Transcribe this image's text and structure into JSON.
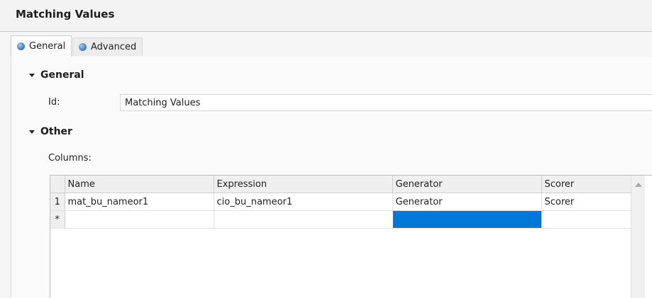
{
  "window": {
    "title": "Matching Values"
  },
  "tabs": [
    {
      "label": "General",
      "icon": "sphere-icon",
      "active": true
    },
    {
      "label": "Advanced",
      "icon": "sphere-icon",
      "active": false
    }
  ],
  "general_section": {
    "header": "General",
    "id_label": "Id:",
    "id_value": "Matching Values"
  },
  "other_section": {
    "header": "Other",
    "columns_label": "Columns:"
  },
  "columns_grid": {
    "headers": [
      "Name",
      "Expression",
      "Generator",
      "Scorer"
    ],
    "rows": [
      {
        "row_header": "1",
        "cells": [
          "mat_bu_nameor1",
          "cio_bu_nameor1",
          "Generator",
          "Scorer"
        ]
      }
    ],
    "new_row_marker": "*"
  },
  "colors": {
    "selection": "#0078d7"
  }
}
